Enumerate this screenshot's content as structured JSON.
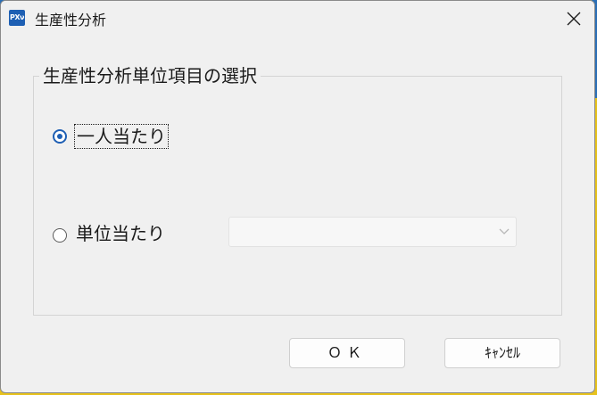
{
  "window": {
    "icon_text": "PXν",
    "title": "生産性分析"
  },
  "group": {
    "legend": "生産性分析単位項目の選択"
  },
  "options": [
    {
      "label": "一人当たり",
      "checked": true
    },
    {
      "label": "単位当たり",
      "checked": false
    }
  ],
  "unit_select": {
    "value": ""
  },
  "buttons": {
    "ok": "ＯＫ",
    "cancel": "ｷｬﾝｾﾙ"
  },
  "colors": {
    "accent": "#1e5fb4",
    "window_bg": "#f0f0f0",
    "desktop_bg": "#e7c21c"
  }
}
